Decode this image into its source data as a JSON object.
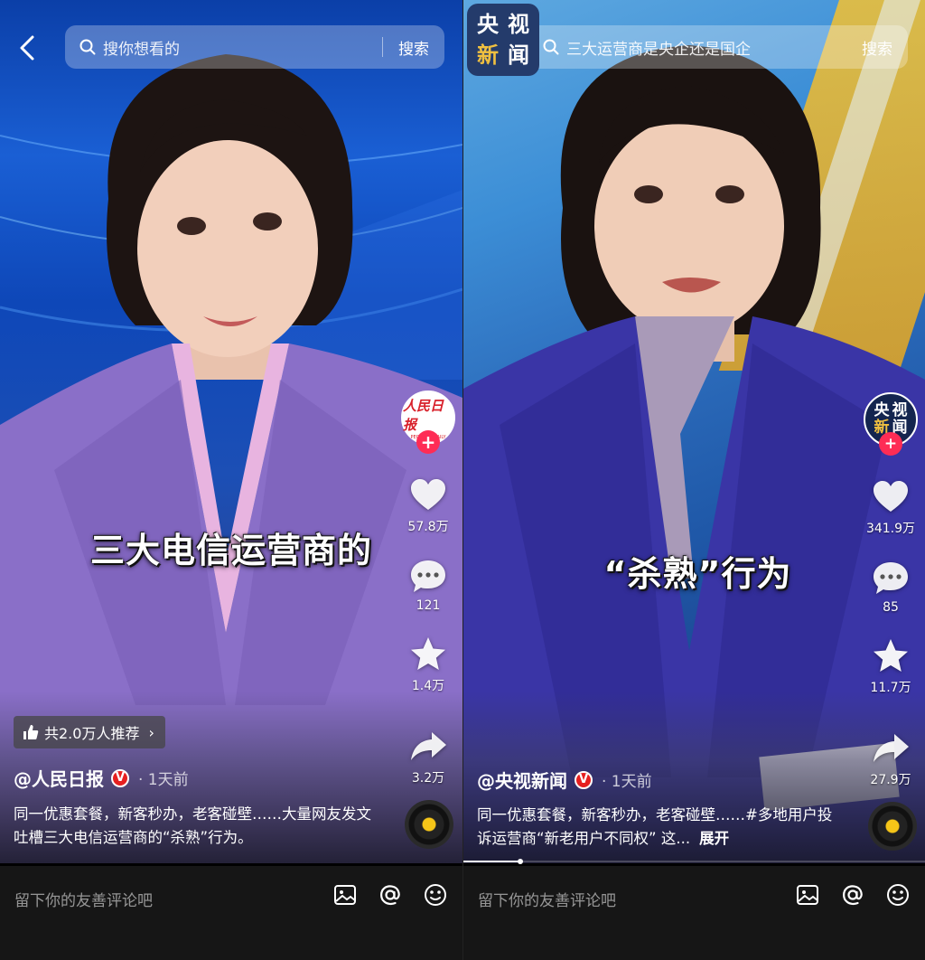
{
  "left": {
    "search": {
      "placeholder": "搜你想看的",
      "button": "搜索"
    },
    "caption": "三大电信运营商的",
    "avatar_text": "人民日报",
    "avatar_subtext": "PEOPLE'S DAILY",
    "actions": {
      "likes": "57.8万",
      "comments": "121",
      "favorites": "1.4万",
      "shares": "3.2万"
    },
    "recommend": "共2.0万人推荐",
    "author": "@人民日报",
    "verified": "V",
    "time": "· 1天前",
    "description": "同一优惠套餐，新客秒办，老客碰壁……大量网友发文吐槽三大电信运营商的“杀熟”行为。",
    "comment_placeholder": "留下你的友善评论吧"
  },
  "right": {
    "logo": [
      "央",
      "视",
      "新",
      "闻"
    ],
    "search": {
      "placeholder": "三大运营商是央企还是国企",
      "button": "搜索"
    },
    "caption": "“杀熟”行为",
    "avatar_chars": [
      "央",
      "视",
      "新",
      "闻"
    ],
    "actions": {
      "likes": "341.9万",
      "comments": "85",
      "favorites": "11.7万",
      "shares": "27.9万"
    },
    "author": "@央视新闻",
    "verified": "V",
    "time": "· 1天前",
    "description": "同一优惠套餐，新客秒办，老客碰壁……#多地用户投诉运营商“新老用户不同权” 这...",
    "expand": "展开",
    "comment_placeholder": "留下你的友善评论吧"
  },
  "colors": {
    "accent": "#fe2c55",
    "verified": "#e62020",
    "disc_center": "#f5c518"
  },
  "icons": [
    "back-icon",
    "search-icon",
    "heart-icon",
    "comment-icon",
    "star-icon",
    "share-icon",
    "thumbs-up-icon",
    "image-icon",
    "at-icon",
    "emoji-icon",
    "music-disc-icon"
  ]
}
